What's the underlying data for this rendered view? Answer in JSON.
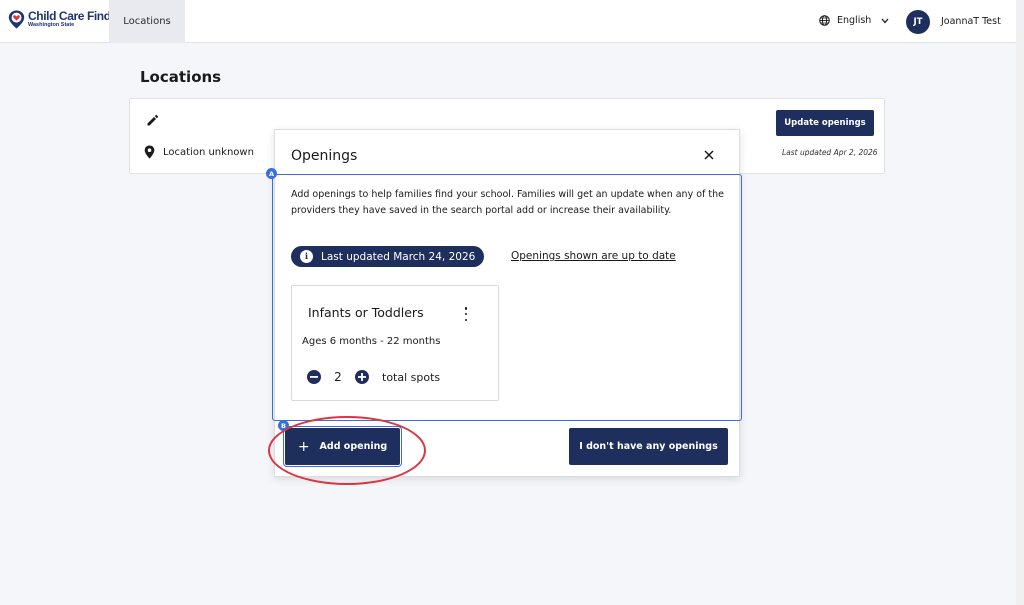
{
  "brand": {
    "title": "Child Care Finder",
    "subtitle": "Washington State",
    "color": "#1e3473"
  },
  "nav": {
    "tabs": [
      {
        "label": "Locations",
        "active": true
      }
    ]
  },
  "header": {
    "language": "English",
    "user_initials": "JT",
    "user_name": "JoannaT Test"
  },
  "page": {
    "title": "Locations"
  },
  "location_card": {
    "location_text": "Location unknown",
    "update_button": "Update openings",
    "last_updated": "Last updated Apr 2, 2026"
  },
  "modal": {
    "title": "Openings",
    "description": "Add openings to help families find your school. Families will get an update when any of the providers they have saved in the search portal add or increase their availability.",
    "last_updated_pill": "Last updated March 24, 2026",
    "up_to_date_link": "Openings shown are up to date",
    "opening": {
      "title": "Infants or Toddlers",
      "ages": "Ages 6 months - 22 months",
      "count": "2",
      "unit": "total spots"
    },
    "add_button": "Add opening",
    "none_button": "I don't have any openings"
  },
  "markers": {
    "a": "A",
    "b": "B"
  },
  "colors": {
    "primary": "#1e2f5e",
    "marker": "#3b6fd8",
    "highlight": "#d9363e",
    "background": "#f5f6fa"
  },
  "icons": {
    "brand": "map-pin-heart-icon",
    "language": "globe-icon",
    "dropdown": "chevron-down-icon",
    "edit": "pencil-icon",
    "location": "map-pin-icon",
    "close": "close-icon",
    "info": "info-icon",
    "menu": "kebab-menu-icon",
    "decrement": "minus-circle-icon",
    "increment": "plus-circle-icon",
    "add": "plus-icon"
  }
}
